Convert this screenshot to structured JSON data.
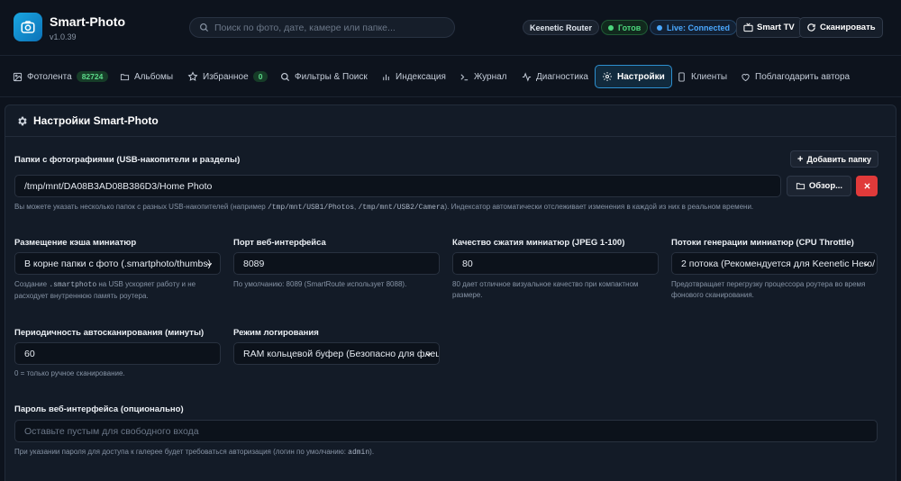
{
  "app": {
    "title": "Smart-Photo",
    "version": "v1.0.39"
  },
  "search": {
    "placeholder": "Поиск по фото, дате, камере или папке..."
  },
  "status": {
    "router": "Keenetic Router",
    "ready": "Готов",
    "live": "Live: Connected"
  },
  "actions": {
    "smart_tv": "Smart TV",
    "scan": "Сканировать"
  },
  "tabs": [
    {
      "label": "Фотолента",
      "badge": "82724"
    },
    {
      "label": "Альбомы"
    },
    {
      "label": "Избранное",
      "badge": "0"
    },
    {
      "label": "Фильтры & Поиск"
    },
    {
      "label": "Индексация"
    },
    {
      "label": "Журнал"
    },
    {
      "label": "Диагностика"
    },
    {
      "label": "Настройки",
      "active": true
    },
    {
      "label": "Клиенты"
    },
    {
      "label": "Поблагодарить автора"
    }
  ],
  "settings": {
    "title": "Настройки Smart-Photo",
    "folders": {
      "label": "Папки с фотографиями (USB-накопители и разделы)",
      "add_button": "Добавить папку",
      "path": "/tmp/mnt/DA08B3AD08B386D3/Home Photo",
      "browse_button": "Обзор...",
      "hint_a": "Вы можете указать несколько папок с разных USB-накопителей (например ",
      "hint_code1": "/tmp/mnt/USB1/Photos",
      "hint_sep": ", ",
      "hint_code2": "/tmp/mnt/USB2/Camera",
      "hint_b": "). Индексатор автоматически отслеживает изменения в каждой из них в реальном времени."
    },
    "cache": {
      "label": "Размещение кэша миниатюр",
      "value": "В корне папки с фото (.smartphoto/thumbs)",
      "hint_a": "Создание ",
      "hint_code": ".smartphoto",
      "hint_b": " на USB ускоряет работу и не расходует внутреннюю память роутера."
    },
    "port": {
      "label": "Порт веб-интерфейса",
      "value": "8089",
      "hint": "По умолчанию: 8089 (SmartRoute использует 8088)."
    },
    "quality": {
      "label": "Качество сжатия миниатюр (JPEG 1-100)",
      "value": "80",
      "hint": "80 дает отличное визуальное качество при компактном размере."
    },
    "threads": {
      "label": "Потоки генерации миниатюр (CPU Throttle)",
      "value": "2 потока (Рекомендуется для Keenetic Hero/",
      "hint": "Предотвращает перегрузку процессора роутера во время фонового сканирования."
    },
    "scan_interval": {
      "label": "Периодичность автосканирования (минуты)",
      "value": "60",
      "hint": "0 = только ручное сканирование."
    },
    "logging": {
      "label": "Режим логирования",
      "value": "RAM кольцевой буфер (Безопасно для флеш"
    },
    "password": {
      "label": "Пароль веб-интерфейса (опционально)",
      "placeholder": "Оставьте пустым для свободного входа",
      "hint_a": "При указании пароля для доступа к галерее будет требоваться авторизация (логин по умолчанию: ",
      "hint_code": "admin",
      "hint_b": ")."
    }
  },
  "colors": {
    "accent": "#2d8fcf",
    "danger": "#e03a3a",
    "success": "#4cd67c",
    "live": "#4aa8ff"
  }
}
